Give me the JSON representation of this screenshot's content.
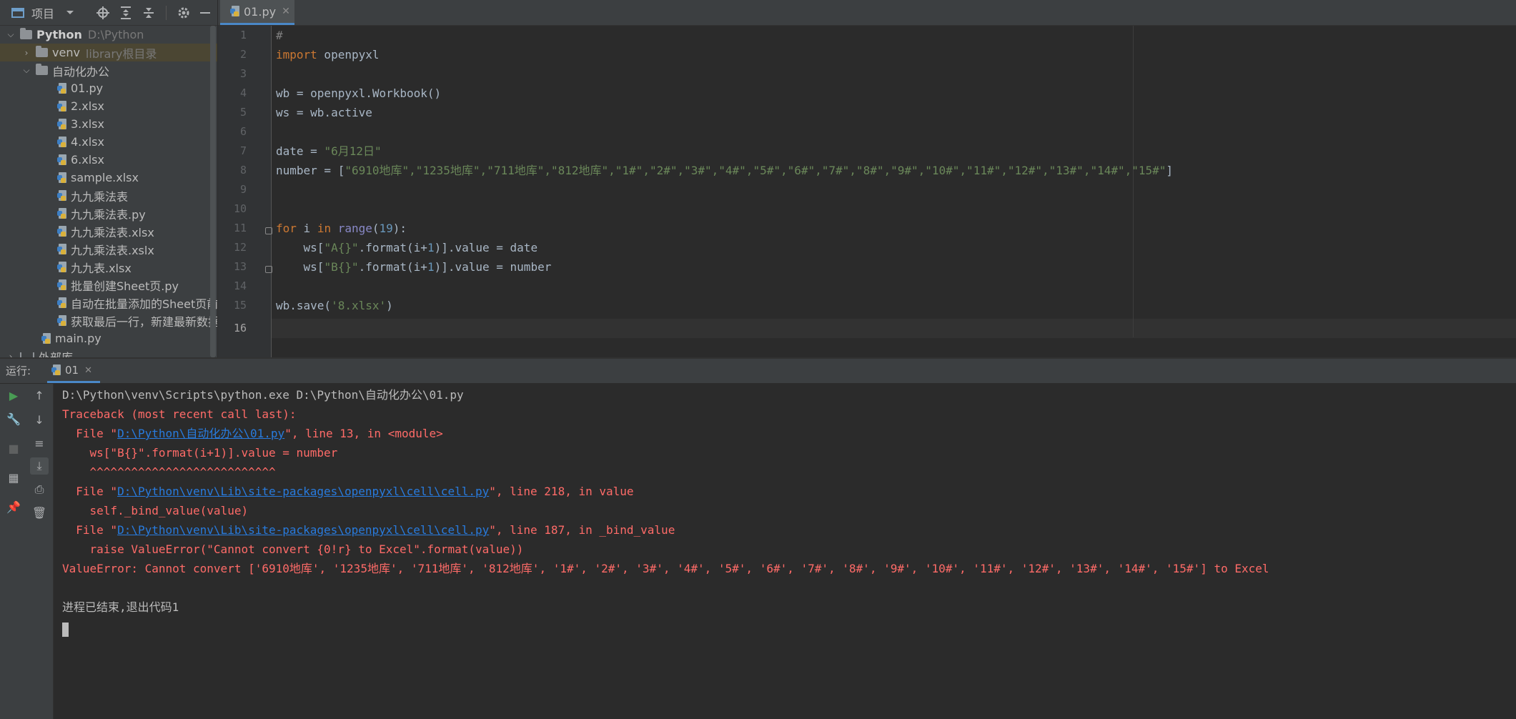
{
  "project_panel": {
    "title": "项目",
    "tree": [
      {
        "label": "Python",
        "hint": "D:\\Python",
        "type": "folder",
        "expanded": true,
        "bold": true
      },
      {
        "label": "venv",
        "hint": "library根目录",
        "type": "folder",
        "expanded": false
      },
      {
        "label": "自动化办公",
        "type": "folder",
        "expanded": true
      },
      {
        "label": "01.py",
        "type": "file"
      },
      {
        "label": "2.xlsx",
        "type": "file"
      },
      {
        "label": "3.xlsx",
        "type": "file"
      },
      {
        "label": "4.xlsx",
        "type": "file"
      },
      {
        "label": "6.xlsx",
        "type": "file"
      },
      {
        "label": "sample.xlsx",
        "type": "file"
      },
      {
        "label": "九九乘法表",
        "type": "file"
      },
      {
        "label": "九九乘法表.py",
        "type": "file"
      },
      {
        "label": "九九乘法表.xlsx",
        "type": "file"
      },
      {
        "label": "九九乘法表.xslx",
        "type": "file"
      },
      {
        "label": "九九表.xlsx",
        "type": "file"
      },
      {
        "label": "批量创建Sheet页.py",
        "type": "file"
      },
      {
        "label": "自动在批量添加的Sheet页前加",
        "type": "file"
      },
      {
        "label": "获取最后一行，新建最新数据.p",
        "type": "file"
      },
      {
        "label": "main.py",
        "type": "file"
      },
      {
        "label": "外部库",
        "type": "folder",
        "expanded": false
      }
    ]
  },
  "editor": {
    "tab_label": "01.py",
    "line_numbers": [
      "1",
      "2",
      "3",
      "4",
      "5",
      "6",
      "7",
      "8",
      "9",
      "10",
      "11",
      "12",
      "13",
      "14",
      "15",
      "16"
    ]
  },
  "run_panel": {
    "label": "运行:",
    "tab_label": "01",
    "console": {
      "cmd": "D:\\Python\\venv\\Scripts\\python.exe D:\\Python\\自动化办公\\01.py",
      "traceback_header": "Traceback (most recent call last):",
      "frame1_prefix": "  File \"",
      "frame1_path": "D:\\Python\\自动化办公\\01.py",
      "frame1_suffix": "\", line 13, in <module>",
      "frame1_code": "    ws[\"B{}\".format(i+1)].value = number",
      "frame1_carets": "    ^^^^^^^^^^^^^^^^^^^^^^^^^^^",
      "frame2_prefix": "  File \"",
      "frame2_path": "D:\\Python\\venv\\Lib\\site-packages\\openpyxl\\cell\\cell.py",
      "frame2_suffix": "\", line 218, in value",
      "frame2_code": "    self._bind_value(value)",
      "frame3_prefix": "  File \"",
      "frame3_path": "D:\\Python\\venv\\Lib\\site-packages\\openpyxl\\cell\\cell.py",
      "frame3_suffix": "\", line 187, in _bind_value",
      "frame3_code": "    raise ValueError(\"Cannot convert {0!r} to Excel\".format(value))",
      "error": "ValueError: Cannot convert ['6910地库', '1235地库', '711地库', '812地库', '1#', '2#', '3#', '4#', '5#', '6#', '7#', '8#', '9#', '10#', '11#', '12#', '13#', '14#', '15#'] to Excel",
      "exit": "进程已结束,退出代码1"
    }
  },
  "code": {
    "l1": "#",
    "l2_kw": "import",
    "l2_rest": " openpyxl",
    "l4": "wb = openpyxl.Workbook()",
    "l5": "ws = wb.active",
    "l7_pre": "date = ",
    "l7_str": "\"6月12日\"",
    "l8_pre": "number = [",
    "l8_str": "\"6910地库\",\"1235地库\",\"711地库\",\"812地库\",\"1#\",\"2#\",\"3#\",\"4#\",\"5#\",\"6#\",\"7#\",\"8#\",\"9#\",\"10#\",\"11#\",\"12#\",\"13#\",\"14#\",\"15#\"",
    "l8_post": "]",
    "l11_for": "for",
    "l11_i": " i ",
    "l11_in": "in",
    "l11_sp": " ",
    "l11_range": "range",
    "l11_open": "(",
    "l11_num": "19",
    "l11_close": "):",
    "l12_pre": "    ws[",
    "l12_str": "\"A{}\"",
    "l12_mid": ".format(i+",
    "l12_num": "1",
    "l12_post": ")].value = date",
    "l13_pre": "    ws[",
    "l13_str": "\"B{}\"",
    "l13_mid": ".format(i+",
    "l13_num": "1",
    "l13_post": ")].value = number",
    "l15_pre": "wb.save(",
    "l15_str": "'8.xlsx'",
    "l15_post": ")"
  },
  "colors": {
    "keyword": "#cc7832",
    "string": "#6a8759",
    "number": "#6897bb",
    "error": "#ff6b68",
    "link": "#287bde",
    "accent": "#4a88c7"
  }
}
